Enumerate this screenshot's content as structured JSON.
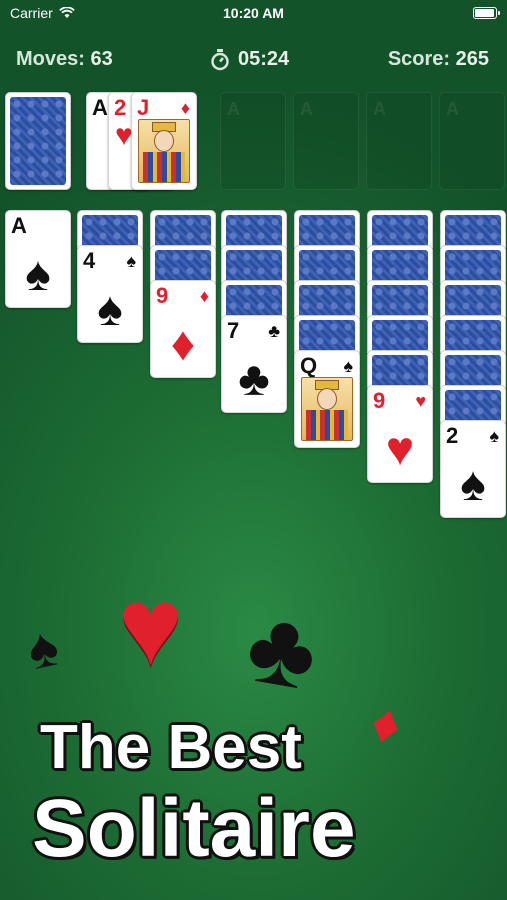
{
  "status": {
    "carrier": "Carrier",
    "time": "10:20 AM",
    "battery_level": 1.0
  },
  "hud": {
    "moves_label": "Moves:",
    "moves_value": "63",
    "timer_value": "05:24",
    "score_label": "Score:",
    "score_value": "265"
  },
  "waste": [
    {
      "rank": "A",
      "suit": "♠"
    },
    {
      "rank": "2",
      "suit": "♥"
    },
    {
      "rank": "J",
      "suit": "♦"
    }
  ],
  "tableau": [
    {
      "rank": "A",
      "suit": "♠"
    },
    {
      "rank": "4",
      "suit": "♠"
    },
    {
      "rank": "9",
      "suit": "♦"
    },
    {
      "rank": "7",
      "suit": "♣"
    },
    {
      "rank": "Q",
      "suit": "♠"
    },
    {
      "rank": "9",
      "suit": "♥"
    },
    {
      "rank": "2",
      "suit": "♠"
    }
  ],
  "foundation_slot_letter": "A",
  "promo": {
    "line1": "The Best",
    "line2": "Solitaire"
  },
  "colors": {
    "felt": "#1d6d34",
    "red_suit": "#e0212d",
    "card_back": "#2f4f9f"
  }
}
